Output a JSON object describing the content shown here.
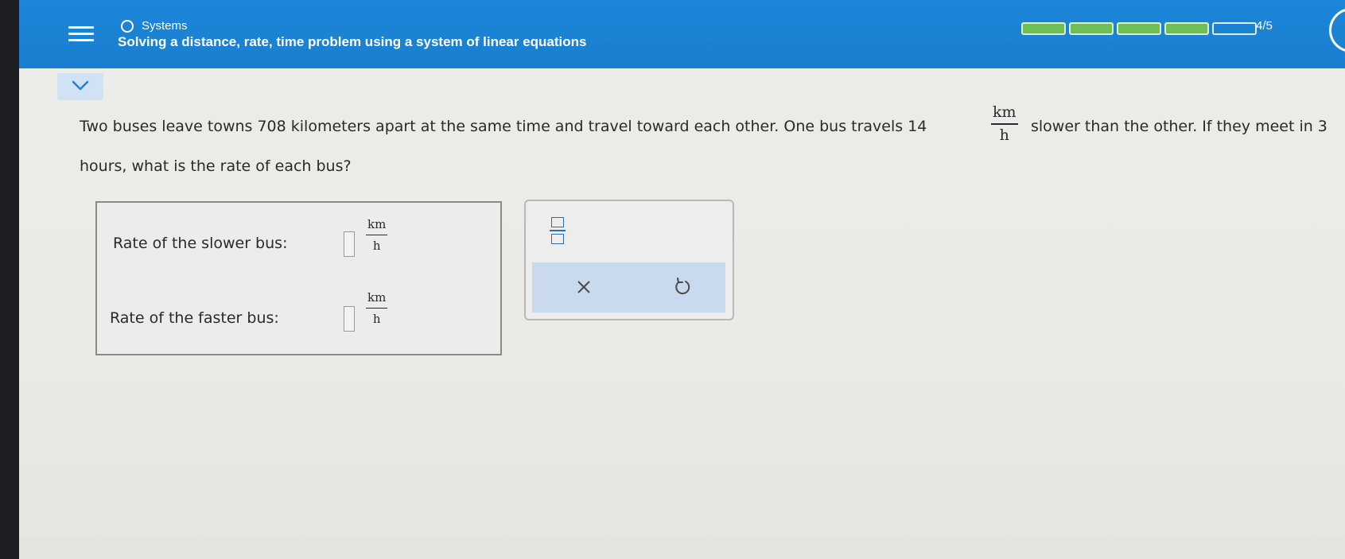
{
  "header": {
    "topic": "Systems",
    "title": "Solving a distance, rate, time problem using a system of linear equations",
    "progress": {
      "completed": 4,
      "total": 5,
      "label": "4/5"
    },
    "menu_icon": "hamburger-icon",
    "colors": {
      "bar": "#1a7fd0",
      "progress_fill": "#6fbf56"
    }
  },
  "collapse_icon": "chevron-down-icon",
  "problem": {
    "text_before": "Two buses leave towns 708 kilometers apart at the same time and travel toward each other. One bus travels 14",
    "unit_num": "km",
    "unit_den": "h",
    "text_after": "slower than the other. If they meet in 3",
    "line2": "hours, what is the rate of each bus?"
  },
  "answers": [
    {
      "label": "Rate of the slower bus:",
      "value": "",
      "unit_num": "km",
      "unit_den": "h"
    },
    {
      "label": "Rate of the faster bus:",
      "value": "",
      "unit_num": "km",
      "unit_den": "h"
    }
  ],
  "tools": {
    "fraction_icon": "fraction-icon",
    "clear_icon": "x-icon",
    "undo_icon": "undo-icon"
  }
}
